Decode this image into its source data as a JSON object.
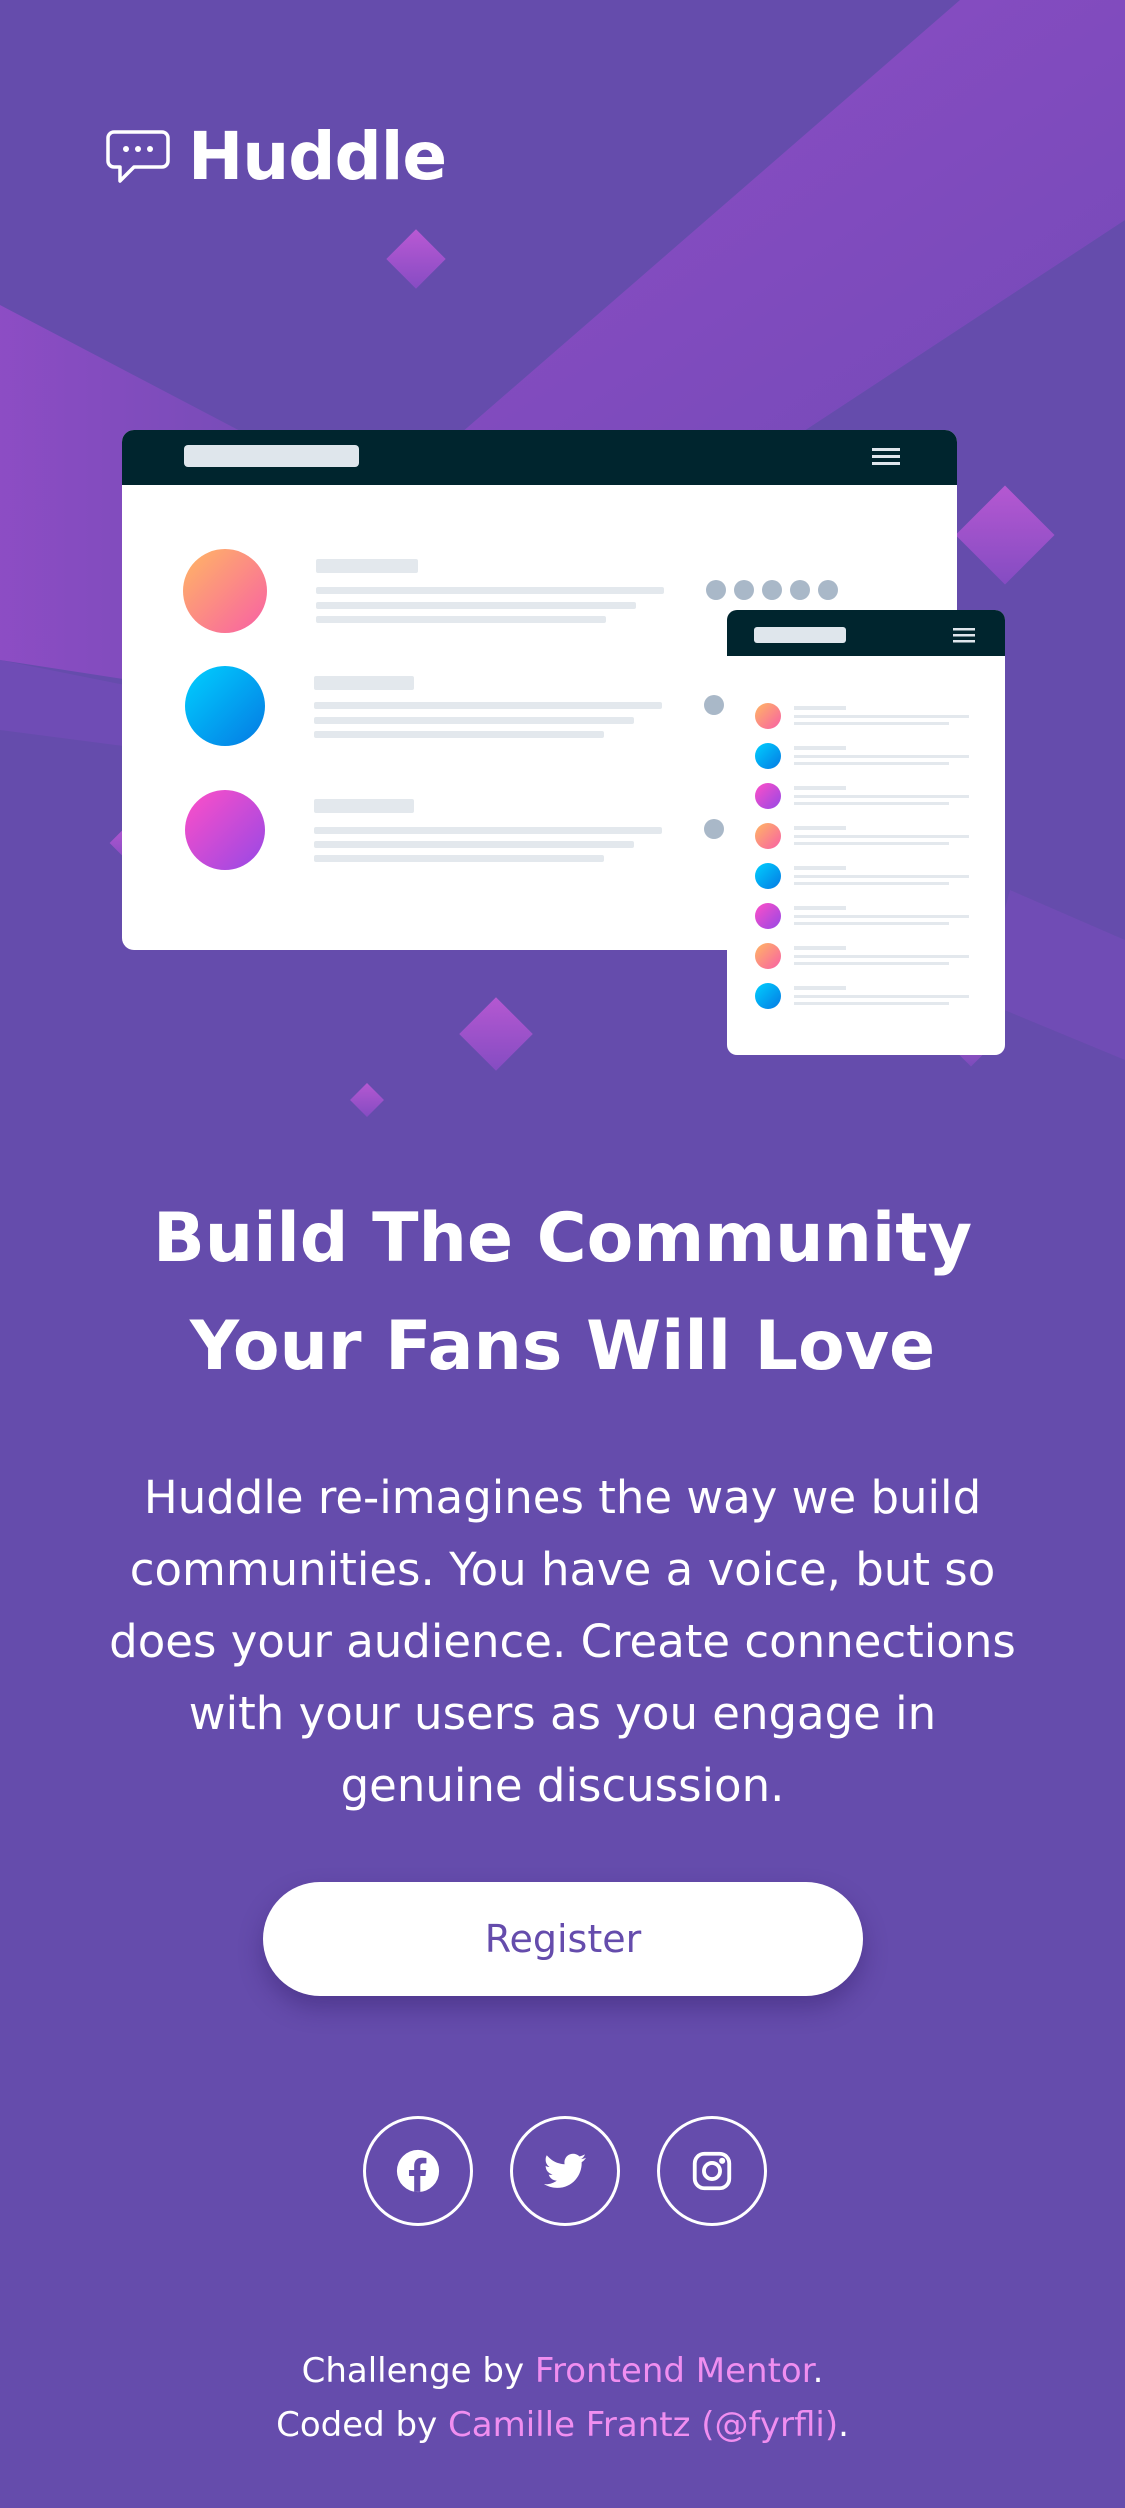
{
  "brand": {
    "name": "Huddle",
    "logo_icon": "chat-bubble-icon"
  },
  "mockup": {
    "desktop": {
      "rows": 3,
      "avatar_colors": [
        "#fb9a72",
        "#00a6f7",
        "#d64fe3"
      ]
    },
    "mobile": {
      "rows": 8,
      "avatar_colors": [
        "#fb9a72",
        "#00a6f7",
        "#d64fe3",
        "#fb9a72",
        "#00a6f7",
        "#d64fe3",
        "#fb9a72",
        "#00a6f7"
      ]
    }
  },
  "hero": {
    "title_line1": "Build The Community",
    "title_line2": "Your Fans Will Love",
    "description": "Huddle re-imagines the way we build communities. You have a voice, but so does your audience. Create connections with your users as you engage in genuine discussion.",
    "register_label": "Register"
  },
  "social": [
    {
      "name": "facebook",
      "icon": "facebook-icon"
    },
    {
      "name": "twitter",
      "icon": "twitter-icon"
    },
    {
      "name": "instagram",
      "icon": "instagram-icon"
    }
  ],
  "attribution": {
    "challenge_prefix": "Challenge by",
    "challenge_link": "Frontend Mentor",
    "challenge_suffix": ".",
    "coded_prefix": "Coded by",
    "coded_link": "Camille Frantz (@fyrfli)",
    "coded_suffix": "."
  },
  "colors": {
    "background": "#654cac",
    "accent_magenta": "#9a4dcc",
    "link_pink": "#f08ef0",
    "mockup_bar": "#00252e",
    "button_text": "#654cac"
  }
}
